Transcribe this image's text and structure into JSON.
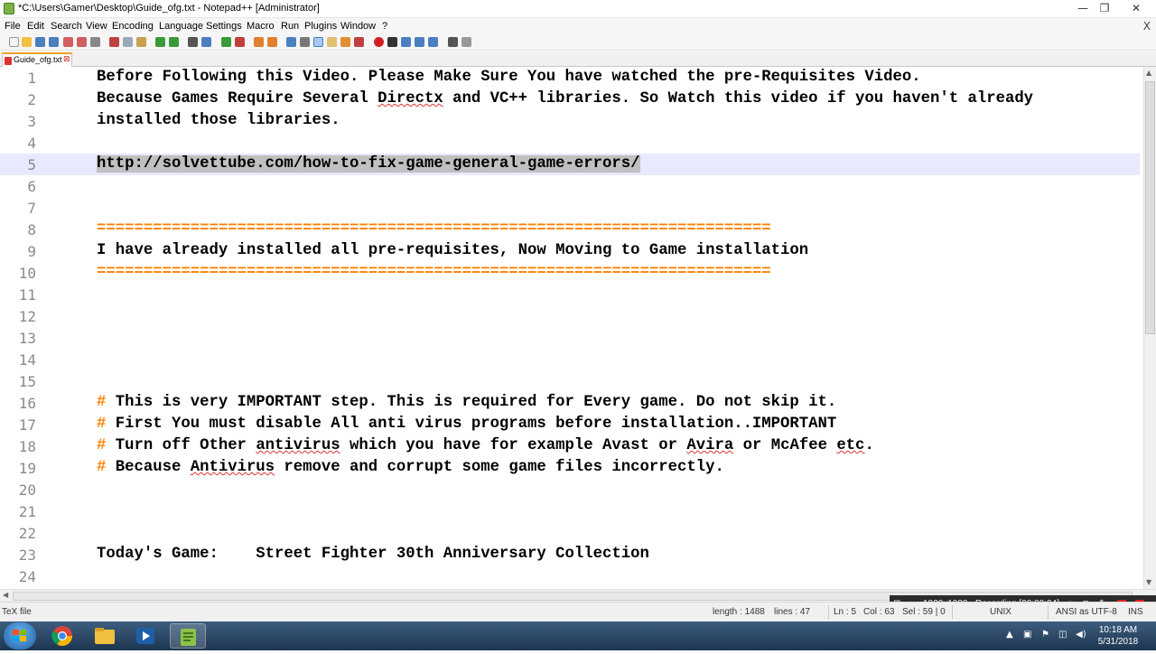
{
  "window": {
    "title": "*C:\\Users\\Gamer\\Desktop\\Guide_ofg.txt - Notepad++ [Administrator]",
    "minimize": "—",
    "maximize": "❐",
    "close": "✕"
  },
  "menu": {
    "items": [
      "File",
      "Edit",
      "Search",
      "View",
      "Encoding",
      "Language",
      "Settings",
      "Macro",
      "Run",
      "Plugins",
      "Window",
      "?"
    ],
    "close_doc": "X"
  },
  "tab": {
    "label": "Guide_ofg.txt",
    "close": "⊠"
  },
  "editor": {
    "lines": [
      {
        "n": "1",
        "text": "Before Following this Video. Please Make Sure You have watched the pre-Requisites Video."
      },
      {
        "n": "2",
        "pre": "Because Games Require Several ",
        "sq": "Directx",
        "post": " and VC++ libraries. So Watch this video if you haven't already"
      },
      {
        "n": "3",
        "text": "installed those libraries."
      },
      {
        "n": "4",
        "text": ""
      },
      {
        "n": "5",
        "url": "http://solvettube.com/how-to-fix-game-general-game-errors/"
      },
      {
        "n": "6",
        "text": ""
      },
      {
        "n": "7",
        "text": ""
      },
      {
        "n": "8",
        "eq": "========================================================================"
      },
      {
        "n": "9",
        "text": "I have already installed all pre-requisites, Now Moving to Game installation"
      },
      {
        "n": "10",
        "eq": "========================================================================"
      },
      {
        "n": "11",
        "text": ""
      },
      {
        "n": "12",
        "text": ""
      },
      {
        "n": "13",
        "text": ""
      },
      {
        "n": "14",
        "text": ""
      },
      {
        "n": "15",
        "text": ""
      },
      {
        "n": "16",
        "hash": "#",
        "text": " This is very IMPORTANT step. This is required for Every game. Do not skip it."
      },
      {
        "n": "17",
        "hash": "#",
        "text": " First You must disable All anti virus programs before installation..IMPORTANT"
      },
      {
        "n": "18",
        "hash": "#",
        "pre": " Turn off Other ",
        "sq": "antivirus",
        "mid": " which you have for example Avast or ",
        "sq2": "Avira",
        "mid2": " or McAfee ",
        "sq3": "etc",
        "post": "."
      },
      {
        "n": "19",
        "hash": "#",
        "pre": " Because ",
        "sq": "Antivirus",
        "post": " remove and corrupt some game files incorrectly."
      },
      {
        "n": "20",
        "text": ""
      },
      {
        "n": "21",
        "text": ""
      },
      {
        "n": "22",
        "text": ""
      },
      {
        "n": "23",
        "text": "Today's Game:    Street Fighter 30th Anniversary Collection"
      },
      {
        "n": "24",
        "text": ""
      }
    ]
  },
  "status": {
    "file_type": "TeX file",
    "length": "length : 1488",
    "lines": "lines : 47",
    "ln": "Ln : 5",
    "col": "Col : 63",
    "sel": "Sel : 59 | 0",
    "eol": "UNIX",
    "encoding": "ANSI as UTF-8",
    "mode": "INS"
  },
  "recording": {
    "resolution": "1920x1080",
    "label": "Recording [00:00:04]"
  },
  "clock": {
    "time": "10:18 AM",
    "date": "5/31/2018"
  },
  "colors": {
    "accent": "#ff8000",
    "selection": "#c0c0c0",
    "current_line": "#e8e8ff"
  }
}
